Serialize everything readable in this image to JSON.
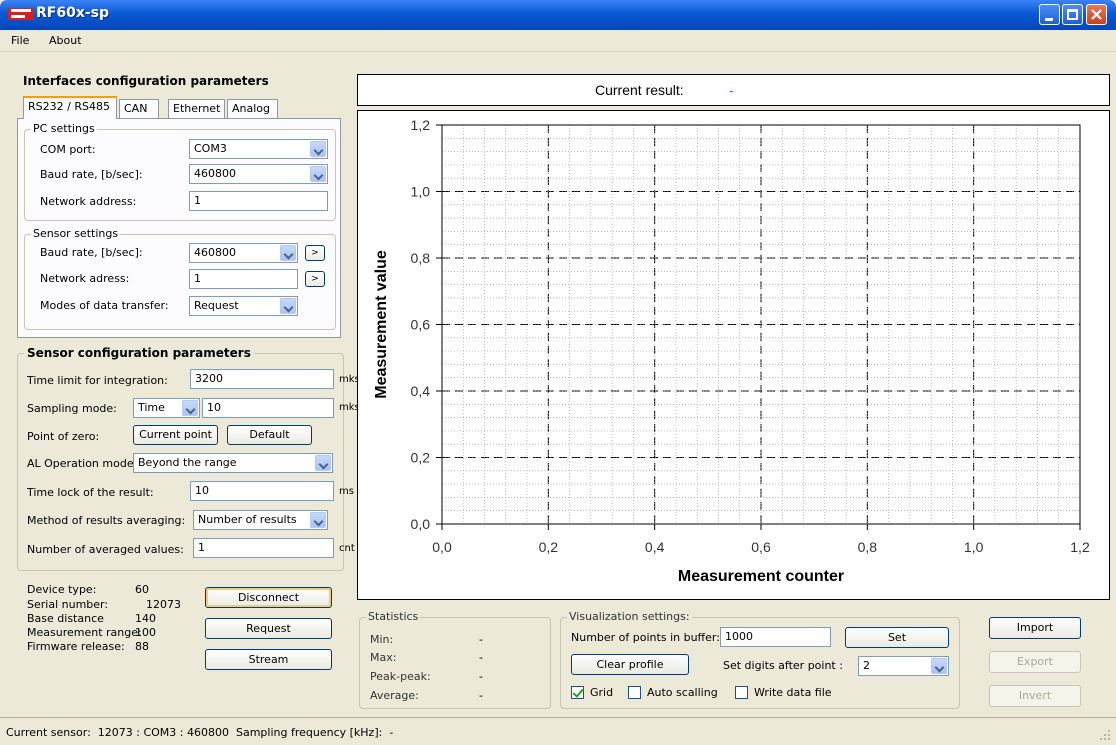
{
  "window": {
    "title": "RF60x-sp"
  },
  "menu": [
    "File",
    "About"
  ],
  "interfaces": {
    "heading": "Interfaces configuration parameters",
    "tabs": [
      "RS232 / RS485",
      "CAN",
      "Ethernet",
      "Analog"
    ],
    "pc_settings": {
      "title": "PC settings",
      "com_port_label": "COM port:",
      "com_port_value": "COM3",
      "baud_label": "Baud rate, [b/sec]:",
      "baud_value": "460800",
      "net_addr_label": "Network address:",
      "net_addr_value": "1"
    },
    "sensor_settings": {
      "title": "Sensor settings",
      "baud_label": "Baud rate, [b/sec]:",
      "baud_value": "460800",
      "net_addr_label": "Network adress:",
      "net_addr_value": "1",
      "mode_label": "Modes of data transfer:",
      "mode_value": "Request",
      "apply_label": ">"
    }
  },
  "sensor_config": {
    "heading": "Sensor configuration parameters",
    "time_limit_label": "Time limit for integration:",
    "time_limit_value": "3200",
    "time_limit_unit": "mks",
    "sampling_label": "Sampling mode:",
    "sampling_mode": "Time",
    "sampling_value": "10",
    "sampling_unit": "mks",
    "zero_label": "Point of zero:",
    "current_point_btn": "Current point",
    "default_btn": "Default",
    "al_label": "AL Operation mode:",
    "al_value": "Beyond the range",
    "time_lock_label": "Time lock of the result:",
    "time_lock_value": "10",
    "time_lock_unit": "ms",
    "averaging_label": "Method of results averaging:",
    "averaging_value": "Number of results",
    "avg_count_label": "Number of averaged values:",
    "avg_count_value": "1",
    "avg_count_unit": "cnt"
  },
  "device": {
    "type_label": "Device type:",
    "type_value": "60",
    "serial_label": "Serial number:",
    "serial_value": "12073",
    "base_label": "Base distance",
    "base_value": "140",
    "range_label": "Measurement range:",
    "range_value": "100",
    "fw_label": "Firmware release:",
    "fw_value": "88",
    "disconnect_btn": "Disconnect",
    "request_btn": "Request",
    "stream_btn": "Stream"
  },
  "current_result": {
    "label": "Current result:",
    "value": "-"
  },
  "chart_data": {
    "type": "line",
    "title": "",
    "xlabel": "Measurement counter",
    "ylabel": "Measurement value",
    "xlim": [
      0,
      1.2
    ],
    "ylim": [
      0,
      1.2
    ],
    "x_ticks": [
      "0,0",
      "0,2",
      "0,4",
      "0,6",
      "0,8",
      "1,0",
      "1,2"
    ],
    "y_ticks": [
      "0,0",
      "0,2",
      "0,4",
      "0,6",
      "0,8",
      "1,0",
      "1,2"
    ],
    "grid": true,
    "series": []
  },
  "statistics": {
    "title": "Statistics",
    "min_label": "Min:",
    "min_value": "-",
    "max_label": "Max:",
    "max_value": "-",
    "pp_label": "Peak-peak:",
    "pp_value": "-",
    "avg_label": "Average:",
    "avg_value": "-"
  },
  "visualization": {
    "title": "Visualization settings:",
    "points_label": "Number of points in buffer:",
    "points_value": "1000",
    "set_btn": "Set",
    "clear_btn": "Clear profile",
    "digits_label": "Set digits after point :",
    "digits_value": "2",
    "grid_label": "Grid",
    "grid_checked": true,
    "autoscale_label": "Auto scalling",
    "autoscale_checked": false,
    "write_label": "Write data file",
    "write_checked": false
  },
  "actions": {
    "import_btn": "Import",
    "export_btn": "Export",
    "invert_btn": "Invert"
  },
  "status": {
    "text": "Current sensor:  12073 : COM3 : 460800  Sampling frequency [kHz]:  -"
  }
}
